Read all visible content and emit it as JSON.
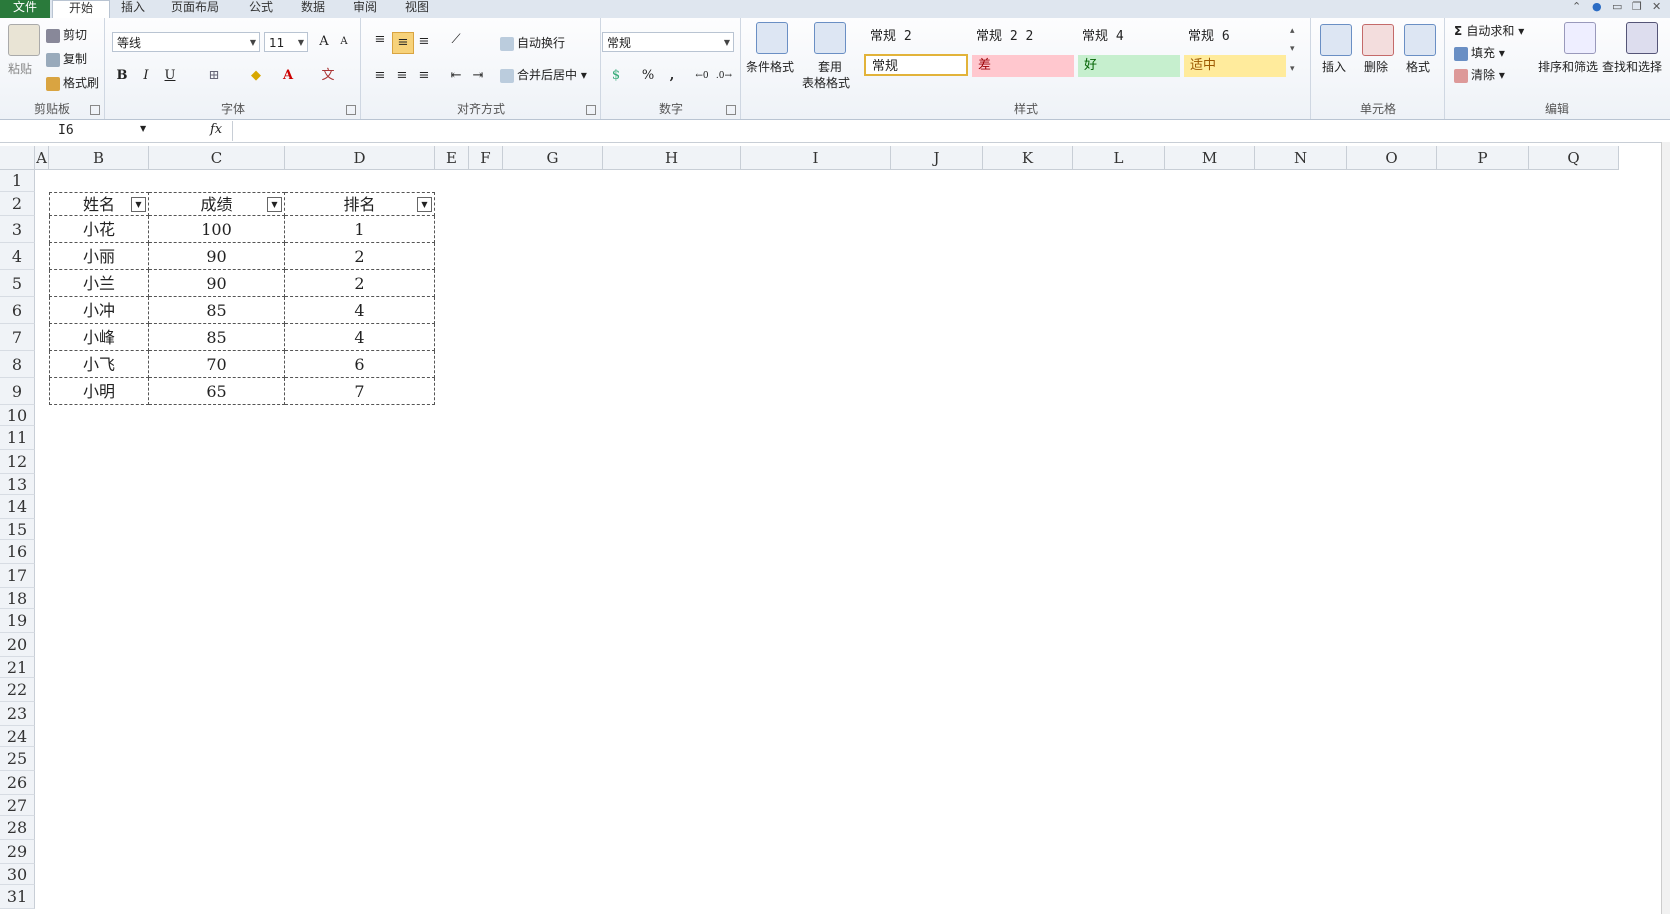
{
  "tabs": [
    "文件",
    "开始",
    "插入",
    "页面布局",
    "公式",
    "数据",
    "审阅",
    "视图"
  ],
  "clipboard": {
    "paste": "粘贴",
    "cut": "剪切",
    "copy": "复制",
    "painter": "格式刷",
    "label": "剪贴板"
  },
  "font": {
    "name": "等线",
    "size": "11",
    "bold": "B",
    "italic": "I",
    "underline": "U",
    "grow": "A",
    "shrink": "A",
    "label": "字体"
  },
  "align": {
    "wrap": "自动换行",
    "merge": "合并后居中",
    "label": "对齐方式"
  },
  "number": {
    "format": "常规",
    "percent": "%",
    "comma": ",",
    "label": "数字"
  },
  "styles": {
    "cond": "条件格式",
    "table1": "套用",
    "table2": "表格格式",
    "r1": [
      "常规 2",
      "常规 2 2",
      "常规 4",
      "常规 6"
    ],
    "normal": "常规",
    "bad": "差",
    "good": "好",
    "neutral": "适中",
    "label": "样式"
  },
  "cells": {
    "insert": "插入",
    "delete": "删除",
    "format": "格式",
    "label": "单元格"
  },
  "editing": {
    "sum": "自动求和",
    "fill": "填充",
    "clear": "清除",
    "sort": "排序和筛选",
    "find": "查找和选择",
    "label": "编辑"
  },
  "formula": {
    "namebox": "I6",
    "fx": "fx",
    "content": ""
  },
  "columns": [
    "A",
    "B",
    "C",
    "D",
    "E",
    "F",
    "G",
    "H",
    "I",
    "J",
    "K",
    "L",
    "M",
    "N",
    "O",
    "P",
    "Q"
  ],
  "rows": [
    "1",
    "2",
    "3",
    "4",
    "5",
    "6",
    "7",
    "8",
    "9",
    "10",
    "11",
    "12",
    "13",
    "14",
    "15",
    "16",
    "17",
    "18",
    "19",
    "20",
    "21",
    "22",
    "23",
    "24",
    "25",
    "26",
    "27",
    "28",
    "29",
    "30",
    "31"
  ],
  "table": {
    "headers": [
      "姓名",
      "成绩",
      "排名"
    ],
    "data": [
      [
        "小花",
        "100",
        "1"
      ],
      [
        "小丽",
        "90",
        "2"
      ],
      [
        "小兰",
        "90",
        "2"
      ],
      [
        "小冲",
        "85",
        "4"
      ],
      [
        "小峰",
        "85",
        "4"
      ],
      [
        "小飞",
        "70",
        "6"
      ],
      [
        "小明",
        "65",
        "7"
      ]
    ]
  }
}
